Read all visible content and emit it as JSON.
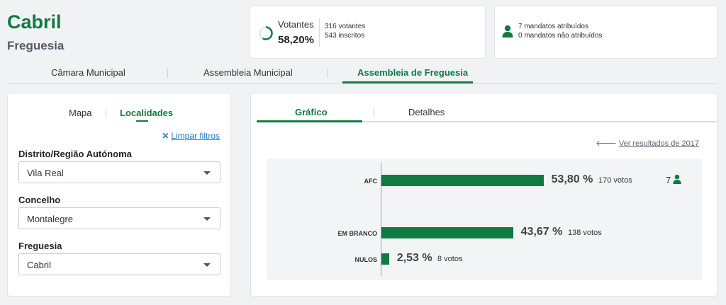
{
  "header": {
    "title": "Cabril",
    "subtitle": "Freguesia"
  },
  "voters": {
    "label": "Votantes",
    "percent": "58,20%",
    "percent_value": 58.2,
    "voters_text": "316 votantes",
    "registered_text": "543 inscritos"
  },
  "mandates": {
    "assigned_text": "7 mandatos atribuídos",
    "unassigned_text": "0 mandatos não atribuídos"
  },
  "nav": {
    "tabs": [
      {
        "label": "Câmara Municipal"
      },
      {
        "label": "Assembleia Municipal"
      },
      {
        "label": "Assembleia de Freguesia"
      }
    ],
    "active": 2
  },
  "left_panel": {
    "tabs": [
      {
        "label": "Mapa"
      },
      {
        "label": "Localidades"
      }
    ],
    "active": 1,
    "clear_filters": "Limpar filtros",
    "filters": [
      {
        "label": "Distrito/Região Autónoma",
        "value": "Vila Real"
      },
      {
        "label": "Concelho",
        "value": "Montalegre"
      },
      {
        "label": "Freguesia",
        "value": "Cabril"
      }
    ]
  },
  "right_panel": {
    "tabs": [
      {
        "label": "Gráfico"
      },
      {
        "label": "Detalhes"
      }
    ],
    "active": 0,
    "previous_results": "Ver resultados de 2017"
  },
  "chart_data": {
    "type": "bar",
    "orientation": "horizontal",
    "categories": [
      "AFC",
      "EM BRANCO",
      "NULOS"
    ],
    "values": [
      53.8,
      43.67,
      2.53
    ],
    "value_labels": [
      "53,80 %",
      "43,67 %",
      "2,53 %"
    ],
    "votes": [
      "170 votos",
      "138 votos",
      "8 votos"
    ],
    "seats": "7",
    "color": "#117a43"
  },
  "colors": {
    "accent": "#117a43",
    "link": "#1a7bc4"
  }
}
